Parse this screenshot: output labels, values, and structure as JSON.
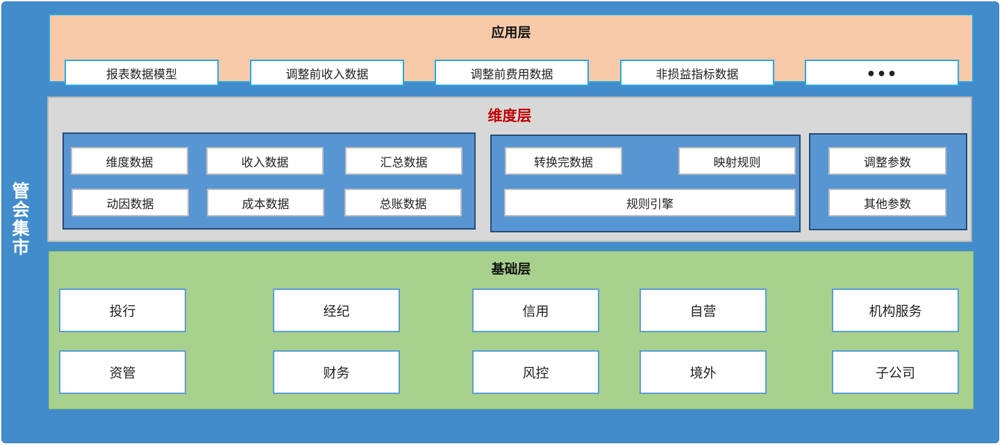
{
  "side_label": [
    "管",
    "会",
    "集",
    "市"
  ],
  "app_layer": {
    "title": "应用层",
    "items": [
      "报表数据模型",
      "调整前收入数据",
      "调整前费用数据",
      "非损益指标数据",
      "•••"
    ]
  },
  "dimension_layer": {
    "title": "维度层",
    "group1": [
      "维度数据",
      "收入数据",
      "汇总数据",
      "动因数据",
      "成本数据",
      "总账数据"
    ],
    "group2": [
      "转换完数据",
      "映射规则",
      "规则引擎"
    ],
    "group3": [
      "调整参数",
      "其他参数"
    ]
  },
  "base_layer": {
    "title": "基础层",
    "items": [
      "投行",
      "经纪",
      "信用",
      "自营",
      "机构服务",
      "资管",
      "财务",
      "风控",
      "境外",
      "子公司"
    ]
  },
  "colors": {
    "frame": "#438ccb",
    "app_bg": "#f8caa9",
    "dim_bg": "#d8d8d8",
    "dim_title": "#c00000",
    "group_bg": "#5896d3",
    "base_bg": "#a8d18d"
  }
}
